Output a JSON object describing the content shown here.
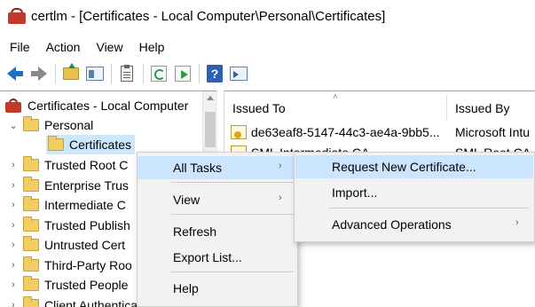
{
  "window": {
    "app_name": "certlm",
    "title": "certlm - [Certificates - Local Computer\\Personal\\Certificates]"
  },
  "menubar": {
    "items": [
      "File",
      "Action",
      "View",
      "Help"
    ]
  },
  "toolbar": {
    "buttons": [
      "back-icon",
      "forward-icon",
      "up-folder-icon",
      "console-tree-icon",
      "clipboard-icon",
      "refresh-icon",
      "export-icon",
      "help-icon",
      "properties-icon"
    ],
    "help_glyph": "?"
  },
  "tree": {
    "root": "Certificates - Local Computer",
    "personal": "Personal",
    "certificates": "Certificates",
    "items": [
      "Trusted Root C",
      "Enterprise Trus",
      "Intermediate C",
      "Trusted Publish",
      "Untrusted Cert",
      "Third-Party Roo",
      "Trusted People",
      "Client Authentication Issue"
    ]
  },
  "list": {
    "columns": [
      "Issued To",
      "Issued By"
    ],
    "rows": [
      {
        "issued_to": "de63eaf8-5147-44c3-ae4a-9bb5...",
        "issued_by": "Microsoft Intu"
      },
      {
        "issued_to": "SML Intermediate CA",
        "issued_by": "SML Root CA"
      }
    ]
  },
  "context_menu": {
    "items": [
      "All Tasks",
      "View",
      "Refresh",
      "Export List...",
      "Help"
    ],
    "highlighted": "All Tasks"
  },
  "submenu": {
    "items": [
      "Request New Certificate...",
      "Import...",
      "Advanced Operations"
    ],
    "highlighted": "Request New Certificate..."
  },
  "colors": {
    "highlight": "#cce5ff",
    "menu_bg": "#f2f2f2",
    "tree_selection": "#cce8ff"
  }
}
